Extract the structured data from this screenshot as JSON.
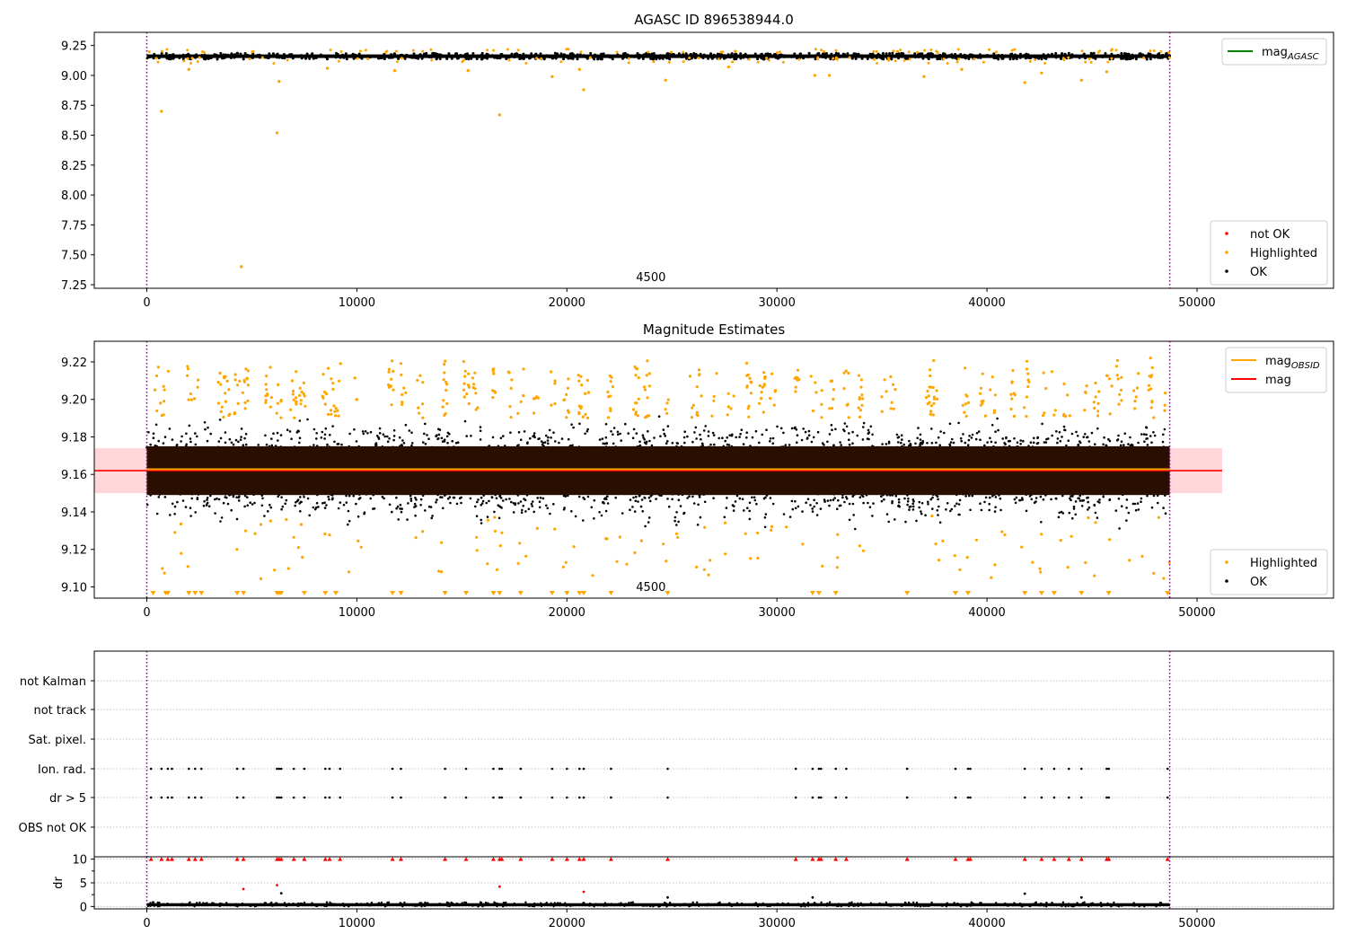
{
  "colors": {
    "ok": "#000000",
    "highlighted": "#ffa500",
    "not_ok": "#ff0000",
    "mag_agasc": "#008000",
    "mag_obsid": "#ffa500",
    "mag": "#ff0000",
    "band_fill": "#ffd6d9",
    "dense_band": "#2a0f00",
    "boundary": "#800080",
    "grid": "#b0b0b0"
  },
  "chart_data": [
    {
      "type": "scatter",
      "title": "AGASC ID 896538944.0",
      "xlabel": "",
      "ylabel": "",
      "xlim": [
        -2500,
        56500
      ],
      "ylim": [
        7.22,
        9.36
      ],
      "x_ticks": [
        "0",
        "10000",
        "20000",
        "30000",
        "40000",
        "50000"
      ],
      "y_ticks": [
        "7.25",
        "7.50",
        "7.75",
        "8.00",
        "8.25",
        "8.50",
        "8.75",
        "9.00",
        "9.25"
      ],
      "vlines": [
        0,
        48700
      ],
      "annotation": {
        "text": "4500",
        "x": 24000
      },
      "series": [
        {
          "name": "OK",
          "color": "black",
          "band": [
            9.13,
            9.2
          ],
          "x_range": [
            0,
            48700
          ]
        },
        {
          "name": "Highlighted",
          "color": "orange",
          "points": [
            [
              700,
              8.7
            ],
            [
              4500,
              7.4
            ],
            [
              6200,
              8.52
            ],
            [
              6300,
              8.95
            ],
            [
              16800,
              8.67
            ],
            [
              20800,
              8.88
            ],
            [
              24700,
              8.96
            ],
            [
              41800,
              8.94
            ],
            [
              44500,
              8.96
            ],
            [
              19300,
              8.99
            ],
            [
              31800,
              9.0
            ],
            [
              32500,
              9.0
            ],
            [
              37000,
              8.99
            ],
            [
              42600,
              9.02
            ],
            [
              2000,
              9.05
            ],
            [
              8600,
              9.06
            ],
            [
              11800,
              9.04
            ],
            [
              15300,
              9.04
            ],
            [
              38800,
              9.05
            ],
            [
              45700,
              9.03
            ],
            [
              20600,
              9.05
            ],
            [
              27700,
              9.07
            ]
          ]
        },
        {
          "name": "not OK",
          "color": "red",
          "points": []
        }
      ],
      "lines": [
        {
          "name": "mag_AGASC",
          "color": "green"
        }
      ],
      "legends": [
        {
          "position": "top-right",
          "items": [
            "mag_AGASC"
          ]
        },
        {
          "position": "bottom-right",
          "items": [
            "not OK",
            "Highlighted",
            "OK"
          ]
        }
      ]
    },
    {
      "type": "scatter",
      "title": "Magnitude Estimates",
      "xlabel": "",
      "ylabel": "",
      "xlim": [
        -2500,
        56500
      ],
      "ylim": [
        9.094,
        9.231
      ],
      "x_ticks": [
        "0",
        "10000",
        "20000",
        "30000",
        "40000",
        "50000"
      ],
      "y_ticks": [
        "9.10",
        "9.12",
        "9.14",
        "9.16",
        "9.18",
        "9.20",
        "9.22"
      ],
      "vlines": [
        0,
        48700
      ],
      "annotation": {
        "text": "4500",
        "x": 24000
      },
      "series": [
        {
          "name": "OK",
          "color": "black",
          "band": [
            9.13,
            9.194
          ],
          "core": [
            9.149,
            9.175
          ],
          "x_range": [
            0,
            48700
          ]
        },
        {
          "name": "Highlighted",
          "color": "orange",
          "outlier_range": [
            [
              9.19,
              9.224
            ],
            [
              9.105,
              9.135
            ]
          ],
          "clipped_markers": "triangle-down at y=9.096"
        }
      ],
      "lines": [
        {
          "name": "mag_OBSID",
          "color": "orange",
          "value": 9.162
        },
        {
          "name": "mag",
          "color": "red",
          "value": 9.162,
          "band": [
            9.15,
            9.174
          ],
          "x_range": [
            -2500,
            51200
          ]
        }
      ],
      "legends": [
        {
          "position": "top-right",
          "items": [
            "mag_OBSID",
            "mag"
          ]
        },
        {
          "position": "bottom-right",
          "items": [
            "Highlighted",
            "OK"
          ]
        }
      ]
    },
    {
      "type": "scatter",
      "title": "",
      "xlabel": "",
      "ylabel": "",
      "xlim": [
        -2500,
        56500
      ],
      "categories": [
        "not Kalman",
        "not track",
        "Sat. pixel.",
        "Ion. rad.",
        "dr > 5",
        "OBS not OK"
      ],
      "vlines": [
        0,
        48700
      ],
      "flag_times": [
        200,
        700,
        1000,
        1200,
        2000,
        2300,
        2600,
        4300,
        4600,
        6200,
        6300,
        6400,
        7000,
        7500,
        8500,
        8700,
        9200,
        11700,
        12100,
        14200,
        15200,
        16500,
        16800,
        16900,
        17800,
        19300,
        20000,
        20600,
        20800,
        22100,
        24800,
        30900,
        31700,
        32000,
        32100,
        32800,
        33300,
        36200,
        38500,
        39100,
        39200,
        41800,
        42600,
        43200,
        43900,
        44500,
        45700,
        45800,
        48600
      ],
      "flagged_categories": [
        "Ion. rad.",
        "dr > 5"
      ]
    },
    {
      "type": "scatter",
      "title": "",
      "xlabel": "",
      "ylabel": "dr",
      "xlim": [
        -2500,
        56500
      ],
      "ylim": [
        -0.5,
        10.5
      ],
      "y_ticks": [
        "0",
        "5",
        "10"
      ],
      "x_ticks": [
        "0",
        "10000",
        "20000",
        "30000",
        "40000",
        "50000"
      ],
      "vlines": [
        0,
        48700
      ],
      "series": [
        {
          "name": "OK",
          "color": "black",
          "band": [
            0,
            0.8
          ],
          "x_range": [
            0,
            48700
          ],
          "points": [
            [
              6400,
              2.8
            ],
            [
              24800,
              1.9
            ],
            [
              31700,
              1.9
            ],
            [
              41800,
              2.7
            ],
            [
              44500,
              1.9
            ]
          ]
        },
        {
          "name": "not OK",
          "color": "red",
          "clipped_at": 10,
          "points": [
            [
              4600,
              3.7
            ],
            [
              6200,
              4.5
            ],
            [
              16800,
              4.2
            ],
            [
              20800,
              3.1
            ]
          ]
        }
      ]
    }
  ]
}
